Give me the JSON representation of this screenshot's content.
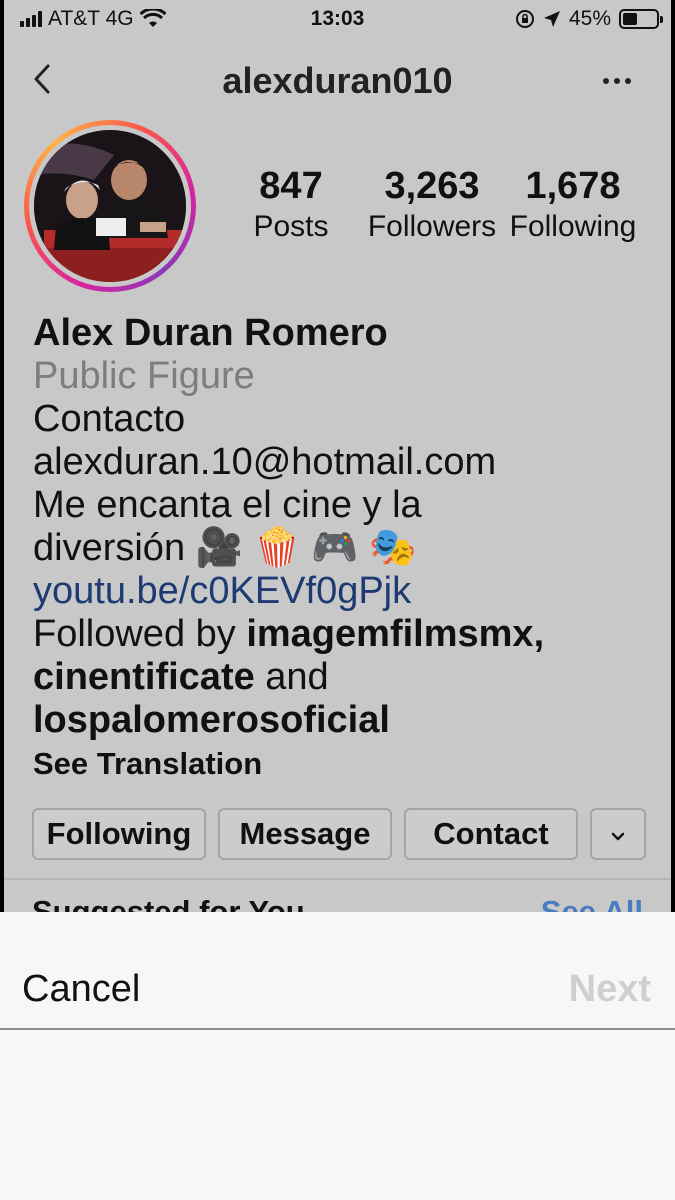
{
  "status_bar": {
    "carrier": "AT&T 4G",
    "time": "13:03",
    "battery_percent": "45%",
    "battery_level": 0.45
  },
  "nav": {
    "username": "alexduran010"
  },
  "stats": {
    "posts": {
      "value": "847",
      "label": "Posts"
    },
    "followers": {
      "value": "3,263",
      "label": "Followers"
    },
    "following": {
      "value": "1,678",
      "label": "Following"
    }
  },
  "bio": {
    "name": "Alex Duran Romero",
    "category": "Public Figure",
    "line1": "Contacto",
    "line2": "alexduran.10@hotmail.com",
    "line3": "Me encanta el cine y la",
    "line4_text": "diversión ",
    "line4_emoji": "🎥 🍿 🎮 🎭",
    "link": "youtu.be/c0KEVf0gPjk",
    "followed_by_prefix": "Followed by ",
    "followed_by_1": "imagemfilmsmx",
    "comma": ",",
    "followed_by_2": "cinentificate",
    "and_text": " and",
    "followed_by_3": "lospalomerosoficial",
    "see_translation": "See Translation"
  },
  "buttons": {
    "following": "Following",
    "message": "Message",
    "contact": "Contact"
  },
  "suggested": {
    "title": "Suggested for You",
    "see_all": "See All"
  },
  "sheet": {
    "cancel": "Cancel",
    "next": "Next"
  }
}
